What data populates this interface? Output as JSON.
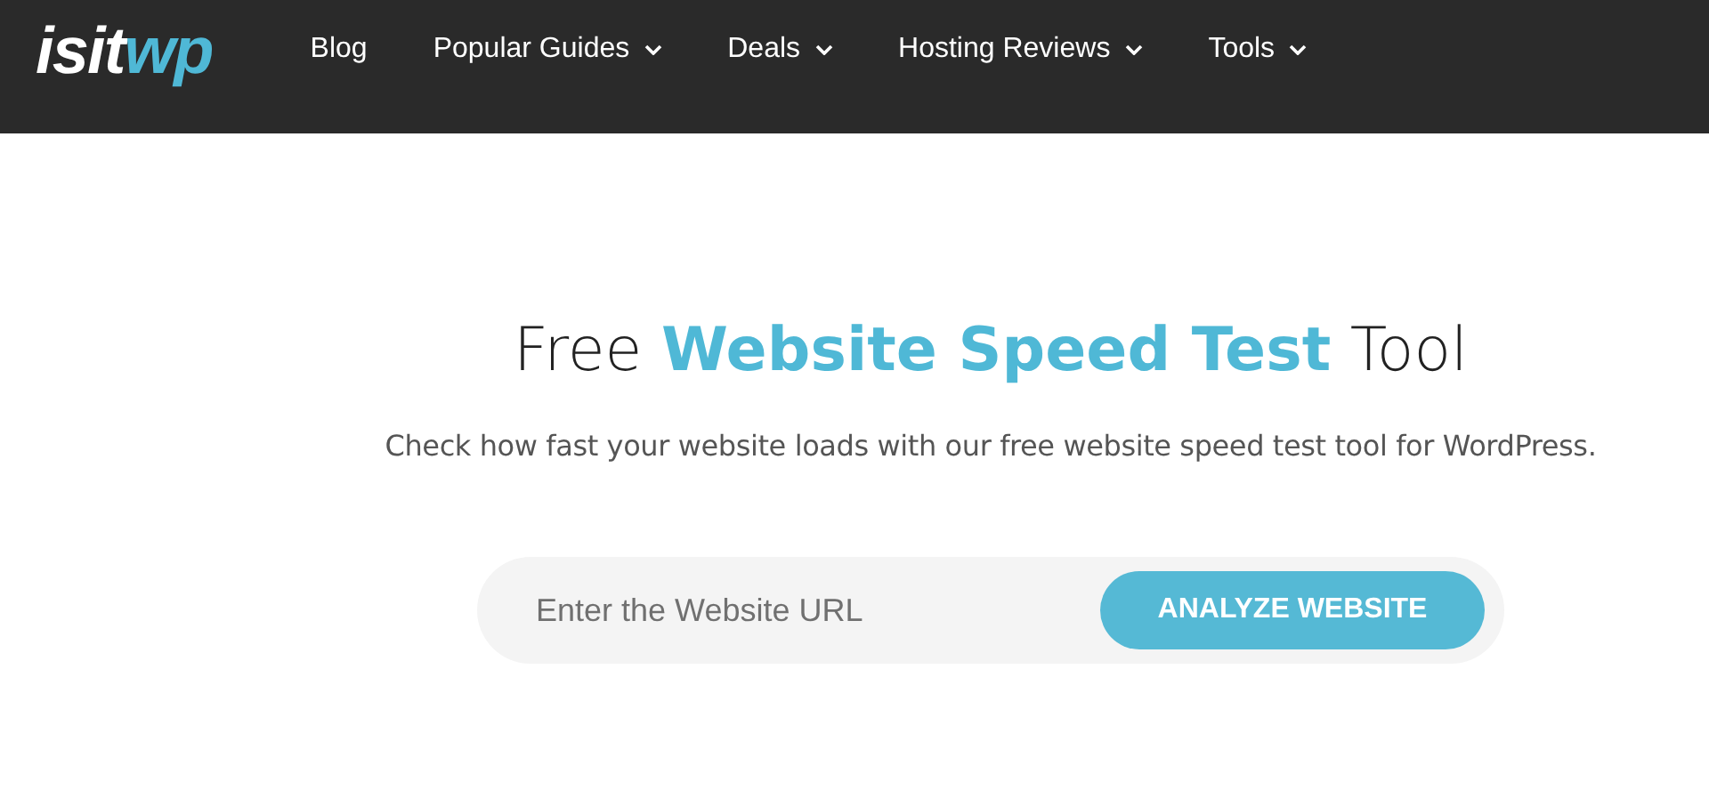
{
  "logo": {
    "text": "isit",
    "accent": "wp"
  },
  "nav": [
    {
      "label": "Blog",
      "dropdown": false
    },
    {
      "label": "Popular Guides",
      "dropdown": true
    },
    {
      "label": "Deals",
      "dropdown": true
    },
    {
      "label": "Hosting Reviews",
      "dropdown": true
    },
    {
      "label": "Tools",
      "dropdown": true
    }
  ],
  "hero": {
    "title": "Free **Website Speed Test** Tool",
    "subtitle": "Check how fast your website loads with our free website speed test tool for WordPress.",
    "url_field": {
      "placeholder": "Enter the Website URL"
    },
    "button": "ANALYZE WEBSITE"
  }
}
